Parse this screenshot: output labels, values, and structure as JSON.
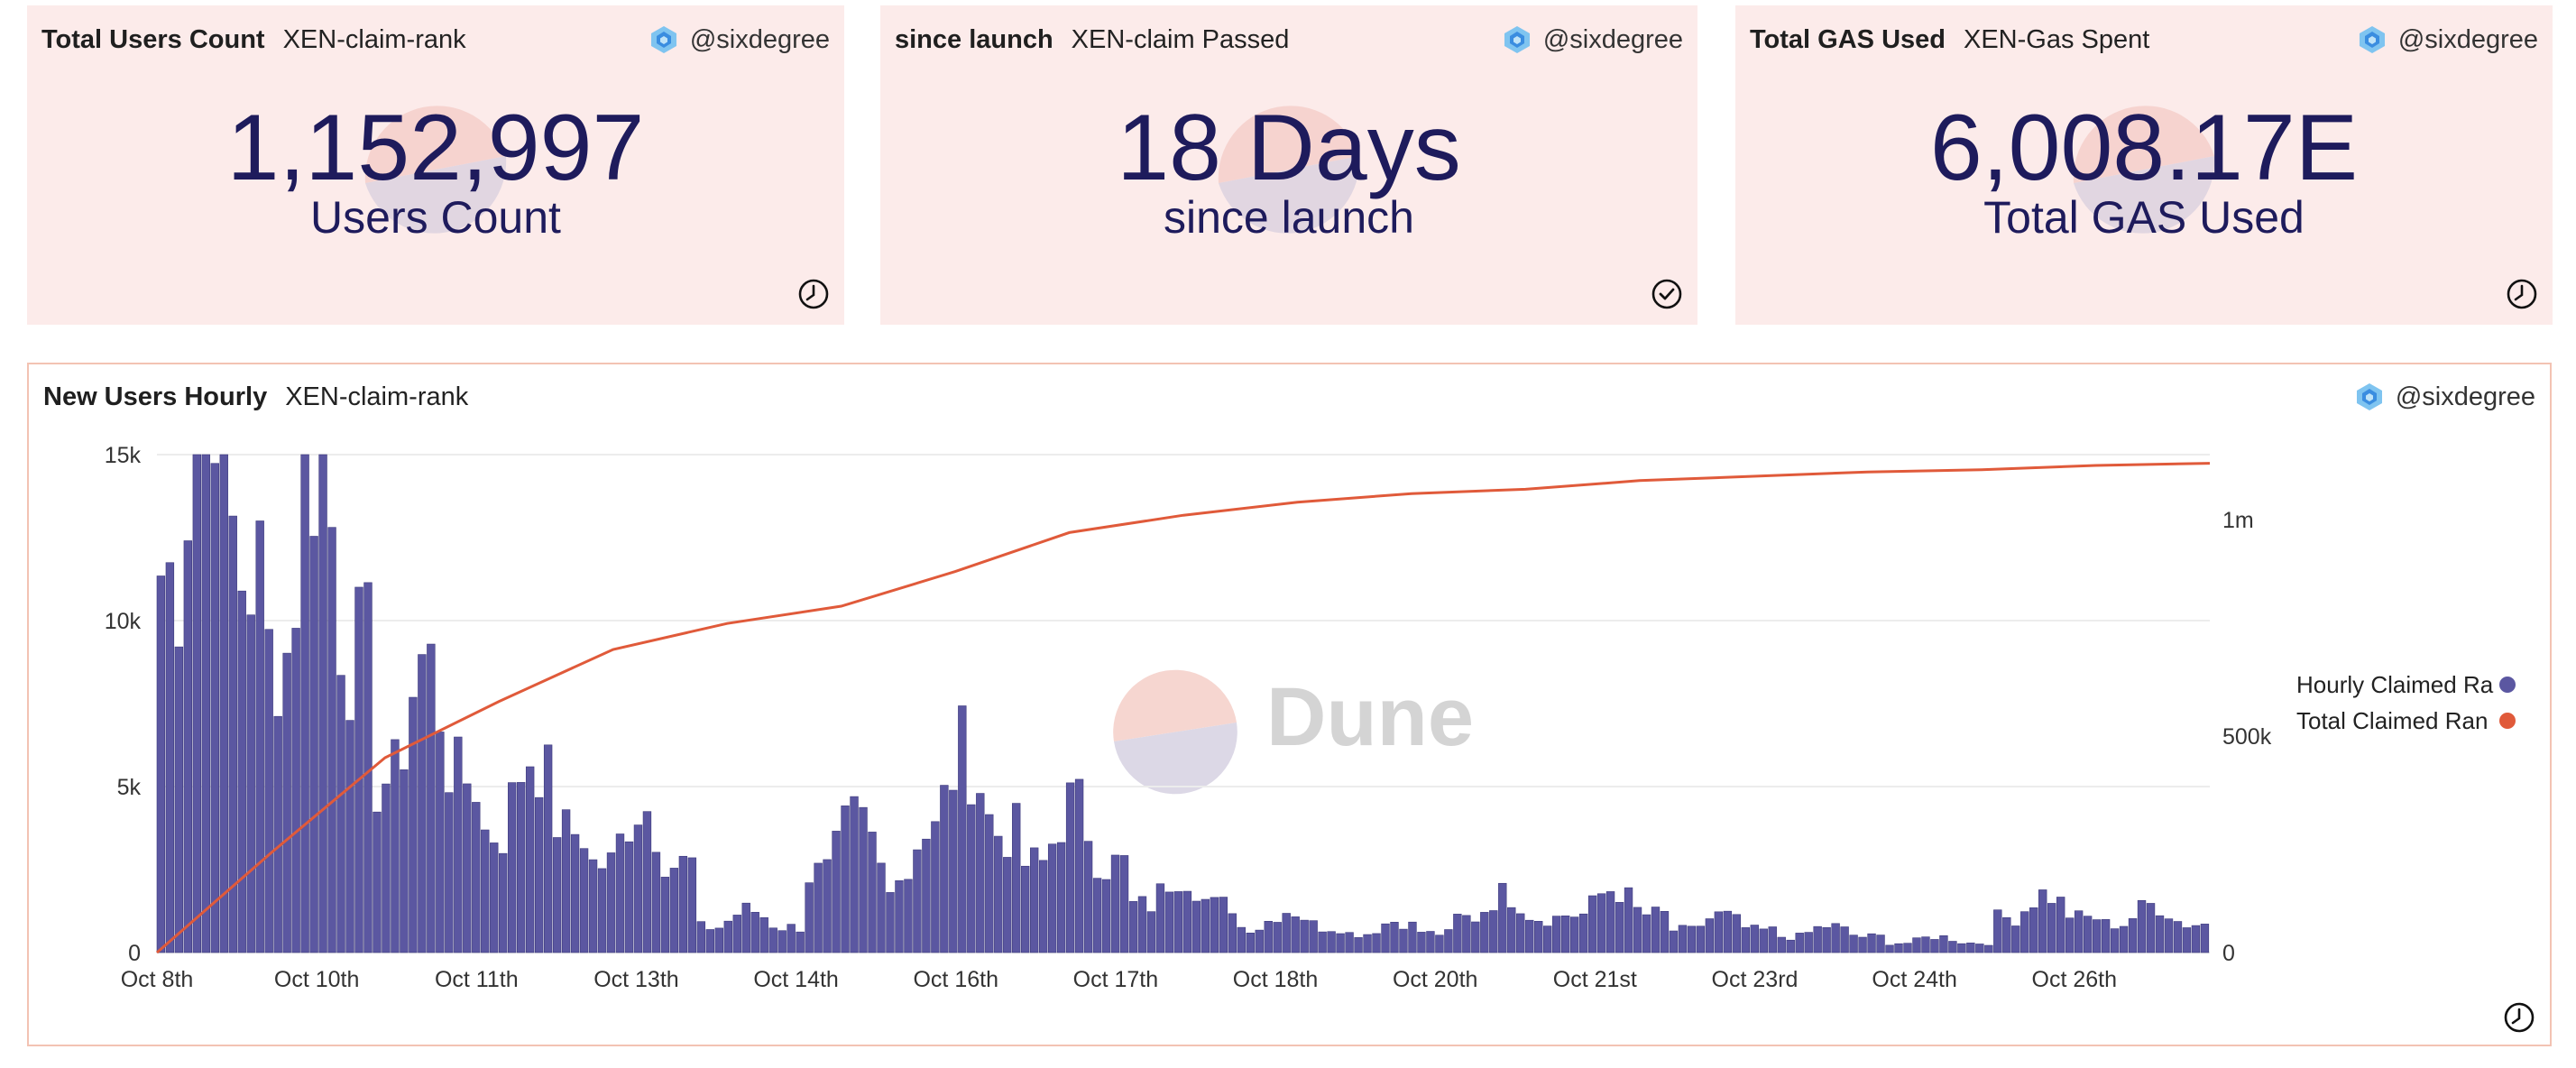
{
  "cards": [
    {
      "title": "Total Users Count",
      "query": "XEN-claim-rank",
      "author": "@sixdegree",
      "value": "1,152,997",
      "label": "Users Count",
      "status_icon": "clock-icon"
    },
    {
      "title": "since launch",
      "query": "XEN-claim Passed",
      "author": "@sixdegree",
      "value": "18 Days",
      "label": "since launch",
      "status_icon": "check-circle-icon"
    },
    {
      "title": "Total GAS Used",
      "query": "XEN-Gas Spent",
      "author": "@sixdegree",
      "value": "6,008.17E",
      "label": "Total GAS Used",
      "status_icon": "clock-icon"
    }
  ],
  "chart_panel": {
    "title": "New Users Hourly",
    "query": "XEN-claim-rank",
    "author": "@sixdegree",
    "watermark": "Dune",
    "status_icon": "clock-icon"
  },
  "colors": {
    "card_bg": "#fcebea",
    "bar": "#5b57a1",
    "line": "#e05a3a",
    "counter_text": "#1e1b5c"
  },
  "chart_data": {
    "type": "bar",
    "x_tick_labels": [
      "Oct 8th",
      "Oct 10th",
      "Oct 11th",
      "Oct 13th",
      "Oct 14th",
      "Oct 16th",
      "Oct 17th",
      "Oct 18th",
      "Oct 20th",
      "Oct 21st",
      "Oct 23rd",
      "Oct 24th",
      "Oct 26th"
    ],
    "y_left_ticks": [
      "0",
      "5k",
      "10k",
      "15k"
    ],
    "y_right_ticks": [
      "0",
      "500k",
      "1m"
    ],
    "ylim_left": [
      0,
      15000
    ],
    "ylim_right": [
      0,
      1150000
    ],
    "legend_position": "right",
    "grid": true,
    "series": [
      {
        "name": "Hourly Claimed Ra",
        "type": "bar",
        "axis": "left",
        "color": "#5b57a1",
        "daily_avg": [
          12000,
          9500,
          5500,
          3800,
          2800,
          800,
          2500,
          3800,
          2800,
          1500,
          800,
          600,
          1100,
          1200,
          700,
          500,
          300,
          1100,
          900
        ]
      },
      {
        "name": "Total Claimed Ran",
        "type": "line",
        "axis": "right",
        "color": "#e05a3a",
        "daily_points": [
          0,
          230000,
          450000,
          580000,
          700000,
          760000,
          800000,
          880000,
          970000,
          1010000,
          1040000,
          1060000,
          1070000,
          1090000,
          1100000,
          1110000,
          1115000,
          1125000,
          1130000
        ]
      }
    ]
  }
}
